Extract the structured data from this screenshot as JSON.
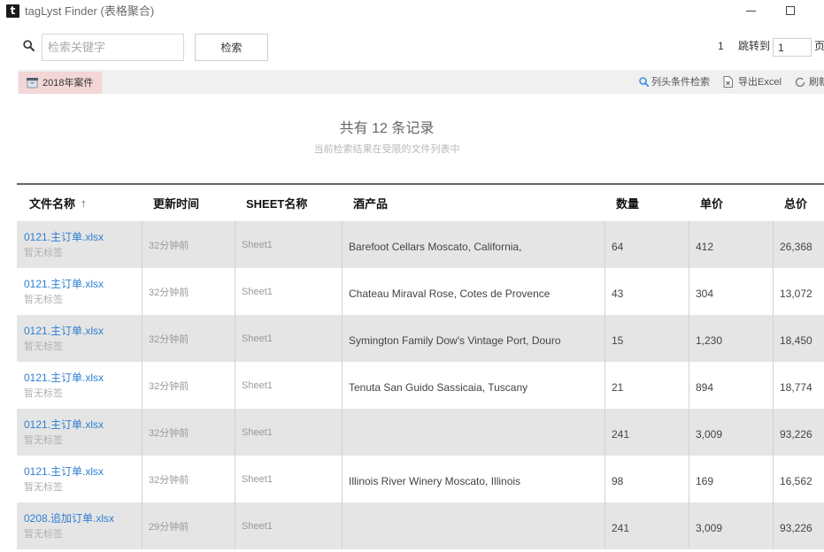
{
  "window": {
    "app_icon_letter": "t",
    "title": "tagLyst Finder (表格聚合)",
    "controls": {
      "minimize_icon": "minimize-icon",
      "maximize_icon": "maximize-icon"
    }
  },
  "search": {
    "icon": "search-icon",
    "placeholder": "检索关键字",
    "value": "",
    "button_label": "检索"
  },
  "pagination": {
    "current_page": "1",
    "jump_label": "跳转到",
    "jump_value": "1",
    "page_unit": "页"
  },
  "toolbar": {
    "tab": {
      "label": "2018年案件",
      "icon": "archive-icon"
    },
    "column_search": {
      "label": "列头条件检索",
      "icon": "search-icon"
    },
    "export": {
      "label": "导出Excel",
      "icon": "excel-export-icon"
    },
    "refresh": {
      "label": "刷新",
      "icon": "refresh-icon"
    }
  },
  "summary": {
    "title": "共有 12 条记录",
    "subtitle": "当前检索结果在受限的文件列表中"
  },
  "table": {
    "sort_indicator": "↑",
    "columns": [
      "文件名称",
      "更新时间",
      "SHEET名称",
      "酒产品",
      "数量",
      "单价",
      "总价"
    ],
    "rows": [
      {
        "file_name": "0121.主订单.xlsx",
        "tag": "暂无标签",
        "updated": "32分钟前",
        "sheet": "Sheet1",
        "product": "Barefoot Cellars Moscato, California,",
        "qty": "64",
        "price": "412",
        "total": "26,368"
      },
      {
        "file_name": "0121.主订单.xlsx",
        "tag": "暂无标签",
        "updated": "32分钟前",
        "sheet": "Sheet1",
        "product": "Chateau Miraval Rose, Cotes de Provence",
        "qty": "43",
        "price": "304",
        "total": "13,072"
      },
      {
        "file_name": "0121.主订单.xlsx",
        "tag": "暂无标签",
        "updated": "32分钟前",
        "sheet": "Sheet1",
        "product": "Symington Family Dow's Vintage Port, Douro",
        "qty": "15",
        "price": "1,230",
        "total": "18,450"
      },
      {
        "file_name": "0121.主订单.xlsx",
        "tag": "暂无标签",
        "updated": "32分钟前",
        "sheet": "Sheet1",
        "product": "Tenuta San Guido Sassicaia, Tuscany",
        "qty": "21",
        "price": "894",
        "total": "18,774"
      },
      {
        "file_name": "0121.主订单.xlsx",
        "tag": "暂无标签",
        "updated": "32分钟前",
        "sheet": "Sheet1",
        "product": "",
        "qty": "241",
        "price": "3,009",
        "total": "93,226"
      },
      {
        "file_name": "0121.主订单.xlsx",
        "tag": "暂无标签",
        "updated": "32分钟前",
        "sheet": "Sheet1",
        "product": "Illinois River Winery Moscato, Illinois",
        "qty": "98",
        "price": "169",
        "total": "16,562"
      },
      {
        "file_name": "0208.追加订单.xlsx",
        "tag": "暂无标签",
        "updated": "29分钟前",
        "sheet": "Sheet1",
        "product": "",
        "qty": "241",
        "price": "3,009",
        "total": "93,226"
      }
    ]
  },
  "colors": {
    "link": "#2d7fd3",
    "row_alt": "#e5e5e5",
    "tab_active": "#f3d6d6",
    "toolbar_bg": "#f0f0f0",
    "accent": "#3a8ee6"
  }
}
